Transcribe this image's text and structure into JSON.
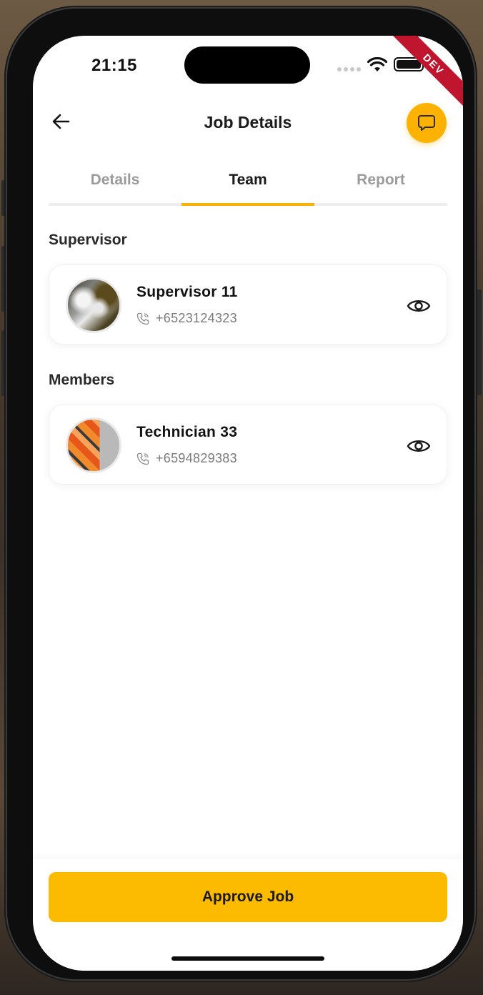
{
  "status_bar": {
    "time": "21:15",
    "build_badge": "DEV"
  },
  "header": {
    "title": "Job Details",
    "back_icon": "arrow-left-icon",
    "chat_icon": "chat-bubble-icon"
  },
  "tabs": [
    {
      "label": "Details",
      "active": false
    },
    {
      "label": "Team",
      "active": true
    },
    {
      "label": "Report",
      "active": false
    }
  ],
  "supervisor_section": {
    "title": "Supervisor",
    "member": {
      "name": "Supervisor 11",
      "phone": "+6523124323"
    }
  },
  "members_section": {
    "title": "Members",
    "members": [
      {
        "name": "Technician 33",
        "phone": "+6594829383"
      }
    ]
  },
  "footer": {
    "approve_label": "Approve Job"
  },
  "colors": {
    "accent": "#fdb100",
    "approve_button": "#fdbb00",
    "dev_ribbon": "#c0152f",
    "tab_inactive": "#9b9b9b"
  }
}
